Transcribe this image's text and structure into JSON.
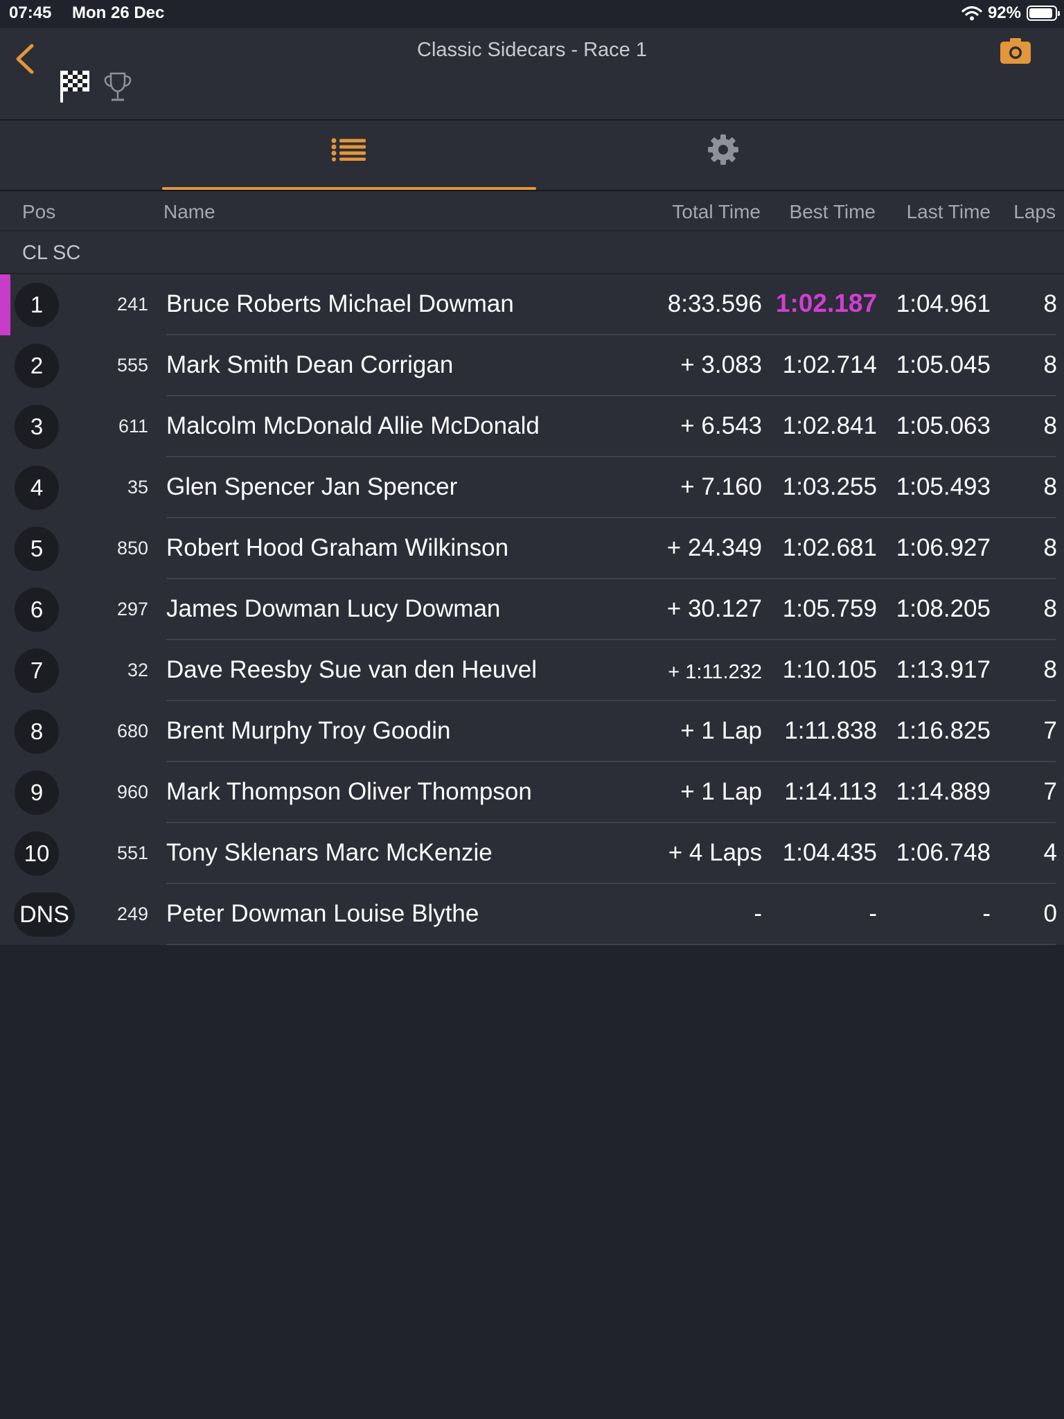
{
  "status_bar": {
    "time": "07:45",
    "date": "Mon 26 Dec",
    "battery_text": "92%",
    "battery_level": 0.92,
    "icons": [
      "wifi-icon",
      "battery-icon"
    ]
  },
  "nav": {
    "title": "Classic Sidecars - Race 1",
    "accent_color": "#e4963a",
    "icons": [
      "back-chevron-icon",
      "checkered-flag-icon",
      "trophy-icon",
      "camera-icon"
    ]
  },
  "tabs": [
    {
      "icon": "list-icon",
      "selected": true
    },
    {
      "icon": "gear-icon",
      "selected": false
    }
  ],
  "table": {
    "columns": {
      "pos": "Pos",
      "name": "Name",
      "total": "Total Time",
      "best": "Best Time",
      "last": "Last Time",
      "laps": "Laps"
    },
    "group_label": "CL SC",
    "fastest_color": "#d23ed2",
    "rows": [
      {
        "pos": "1",
        "no": "241",
        "name": "Bruce Roberts Michael Dowman",
        "total": "8:33.596",
        "best": "1:02.187",
        "last": "1:04.961",
        "laps": "8"
      },
      {
        "pos": "2",
        "no": "555",
        "name": "Mark Smith Dean Corrigan",
        "total": "+ 3.083",
        "best": "1:02.714",
        "last": "1:05.045",
        "laps": "8"
      },
      {
        "pos": "3",
        "no": "611",
        "name": "Malcolm McDonald Allie McDonald",
        "total": "+ 6.543",
        "best": "1:02.841",
        "last": "1:05.063",
        "laps": "8"
      },
      {
        "pos": "4",
        "no": "35",
        "name": "Glen Spencer Jan Spencer",
        "total": "+ 7.160",
        "best": "1:03.255",
        "last": "1:05.493",
        "laps": "8"
      },
      {
        "pos": "5",
        "no": "850",
        "name": "Robert Hood Graham Wilkinson",
        "total": "+ 24.349",
        "best": "1:02.681",
        "last": "1:06.927",
        "laps": "8"
      },
      {
        "pos": "6",
        "no": "297",
        "name": "James Dowman Lucy Dowman",
        "total": "+ 30.127",
        "best": "1:05.759",
        "last": "1:08.205",
        "laps": "8"
      },
      {
        "pos": "7",
        "no": "32",
        "name": "Dave Reesby Sue van den Heuvel",
        "total": "+ 1:11.232",
        "best": "1:10.105",
        "last": "1:13.917",
        "laps": "8"
      },
      {
        "pos": "8",
        "no": "680",
        "name": "Brent Murphy Troy Goodin",
        "total": "+ 1 Lap",
        "best": "1:11.838",
        "last": "1:16.825",
        "laps": "7"
      },
      {
        "pos": "9",
        "no": "960",
        "name": "Mark Thompson Oliver Thompson",
        "total": "+ 1 Lap",
        "best": "1:14.113",
        "last": "1:14.889",
        "laps": "7"
      },
      {
        "pos": "10",
        "no": "551",
        "name": "Tony Sklenars Marc McKenzie",
        "total": "+ 4 Laps",
        "best": "1:04.435",
        "last": "1:06.748",
        "laps": "4"
      },
      {
        "pos": "DNS",
        "no": "249",
        "name": "Peter Dowman Louise Blythe",
        "total": "-",
        "best": "-",
        "last": "-",
        "laps": "0"
      }
    ]
  }
}
